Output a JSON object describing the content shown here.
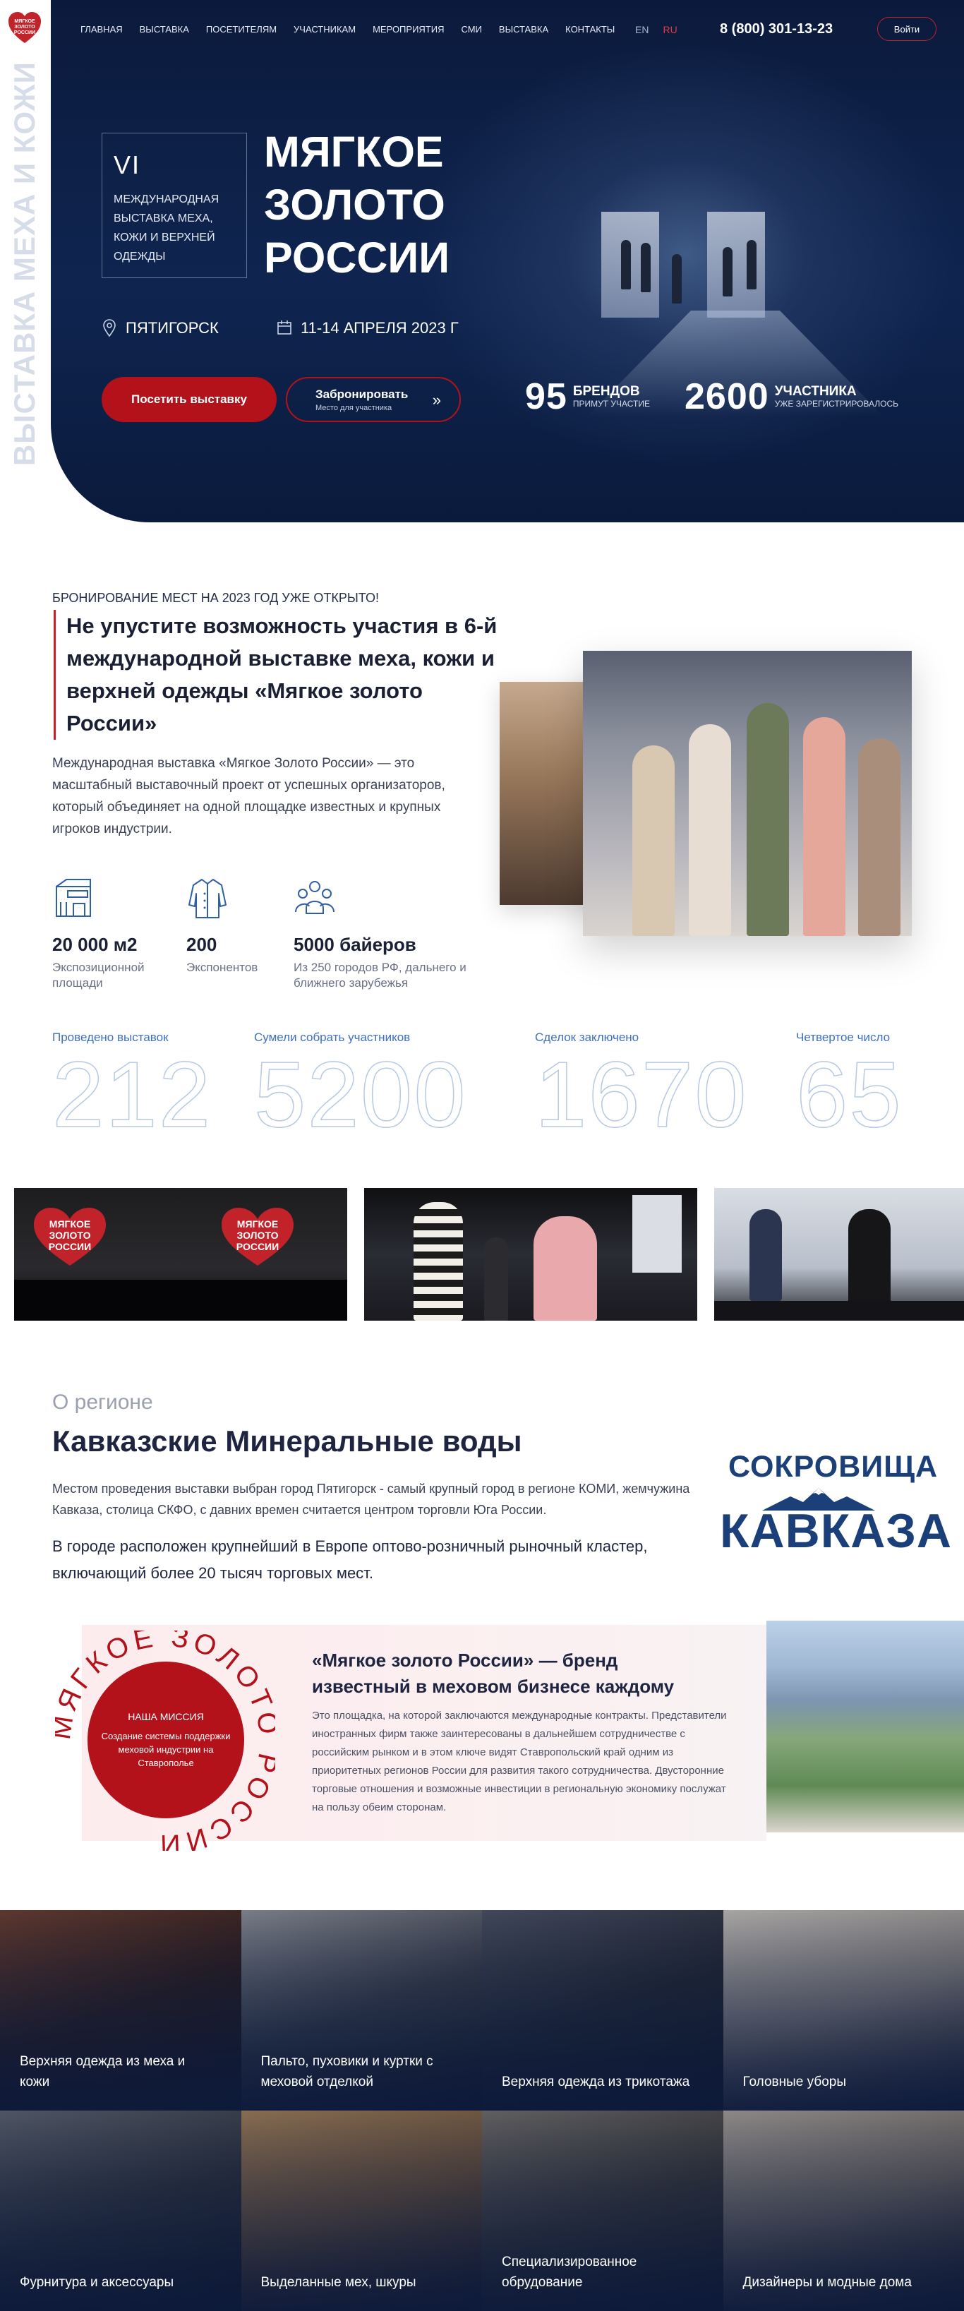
{
  "nav": {
    "items": [
      "ГЛАВНАЯ",
      "ВЫСТАВКА",
      "ПОСЕТИТЕЛЯМ",
      "УЧАСТНИКАМ",
      "МЕРОПРИЯТИЯ",
      "СМИ",
      "ВЫСТАВКА",
      "КОНТАКТЫ"
    ],
    "lang_en": "EN",
    "lang_ru": "RU",
    "phone": "8 (800) 301-13-23",
    "login": "Войти"
  },
  "logo": {
    "line1": "МЯГКОЕ",
    "line2": "ЗОЛОТО",
    "line3": "РОССИИ"
  },
  "hero": {
    "vertical_text": "ВЫСТАВКА МЕХА И КОЖИ",
    "edition_number": "VI",
    "edition_text": "МЕЖДУНАРОДНАЯ ВЫСТАВКА МЕХА, КОЖИ И ВЕРХНЕЙ ОДЕЖДЫ",
    "title": "МЯГКОЕ ЗОЛОТО РОССИИ",
    "city": "ПЯТИГОРСК",
    "dates": "11-14 АПРЕЛЯ 2023 Г",
    "visit_button": "Посетить выставку",
    "book_button": "Забронировать",
    "book_button_sub": "Место для участника",
    "stats": [
      {
        "value": "95",
        "label": "БРЕНДОВ",
        "sub": "ПРИМУТ УЧАСТИЕ"
      },
      {
        "value": "2600",
        "label": "УЧАСТНИКА",
        "sub": "УЖЕ ЗАРЕГИСТРИРОВАЛОСЬ"
      }
    ]
  },
  "about": {
    "booking_open": "БРОНИРОВАНИЕ МЕСТ НА 2023 ГОД УЖЕ ОТКРЫТО!",
    "title": "Не упустите возможность участия в 6-й международной выставке меха, кожи и верхней одежды «Мягкое золото России»",
    "description": "Международная выставка «Мягкое Золото России» — это масштабный выставочный проект от успешных организаторов, который объединяет на одной площадке известных и крупных игроков индустрии.",
    "features": [
      {
        "icon": "mall-icon",
        "value": "20 000 м2",
        "desc": "Экспозиционной площади"
      },
      {
        "icon": "jacket-icon",
        "value": "200",
        "desc": "Экспонентов"
      },
      {
        "icon": "people-icon",
        "value": "5000 байеров",
        "desc": "Из 250 городов РФ, дальнего и ближнего зарубежья"
      }
    ]
  },
  "counters": [
    {
      "label": "Проведено выставок",
      "value": "212"
    },
    {
      "label": "Сумели собрать участников",
      "value": "5200"
    },
    {
      "label": "Сделок заключено",
      "value": "1670"
    },
    {
      "label": "Четвертое число",
      "value": "65"
    }
  ],
  "gallery": {
    "brand_text_1": "МЯГКОЕ",
    "brand_text_2": "ЗОЛОТО",
    "brand_text_3": "РОССИИ"
  },
  "region": {
    "label": "О регионе",
    "title": "Кавказские Минеральные воды",
    "paragraph1": "Местом проведения выставки выбран город Пятигорск - самый крупный город в регионе КОМИ, жемчужина Кавказа, столица СКФО, с давних времен считается центром торговли Юга России.",
    "paragraph2": "В городе расположен крупнейший в Европе оптово-розничный рыночный кластер, включающий более 20 тысяч торговых мест.",
    "logo_top": "СОКРОВИЩА",
    "logo_bottom": "КАВКАЗА"
  },
  "mission": {
    "ring_text": "МЯГКОЕ ЗОЛОТО РОССИИ",
    "label": "НАША МИССИЯ",
    "text": "Создание системы поддержки меховой индустрии на Ставрополье",
    "brand_title": "«Мягкое золото России» — бренд известный в меховом бизнесе каждому",
    "brand_desc": "Это площадка, на которой заключаются международные контракты. Представители иностранных фирм также заинтересованы в дальнейшем сотрудничестве с российским рынком и в этом ключе видят Ставропольский край одним из приоритетных регионов России для развития такого сотрудничества. Двусторонние торговые отношения и возможные инвестиции в региональную экономику послужат на пользу обеим сторонам."
  },
  "categories": [
    {
      "label": "Верхняя одежда из меха и кожи"
    },
    {
      "label": "Пальто, пуховики и куртки с меховой отделкой"
    },
    {
      "label": "Верхняя одежда из трикотажа"
    },
    {
      "label": "Головные уборы"
    },
    {
      "label": "Фурнитура и аксессуары"
    },
    {
      "label": "Выделанные мех, шкуры"
    },
    {
      "label": "Специализированное обрудование"
    },
    {
      "label": "Дизайнеры и модные дома"
    }
  ],
  "colors": {
    "accent_red": "#b3121b",
    "navy": "#0b1a3c",
    "counter_blue": "#3e6fbd"
  }
}
